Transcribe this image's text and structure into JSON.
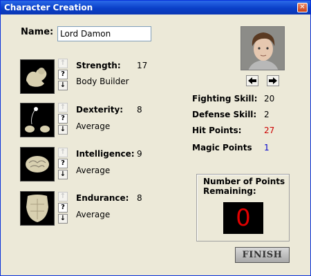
{
  "window": {
    "title": "Character Creation",
    "close_icon": "close-icon"
  },
  "name": {
    "label": "Name:",
    "value": "Lord Damon"
  },
  "attributes": [
    {
      "label": "Strength:",
      "value": "17",
      "description": "Body Builder",
      "icon": "flexed-arm-icon",
      "up_enabled": false,
      "down_enabled": true
    },
    {
      "label": "Dexterity:",
      "value": "8",
      "description": "Average",
      "icon": "juggling-hands-icon",
      "up_enabled": false,
      "down_enabled": true
    },
    {
      "label": "Intelligence:",
      "value": "9",
      "description": "Average",
      "icon": "brain-icon",
      "up_enabled": false,
      "down_enabled": true
    },
    {
      "label": "Endurance:",
      "value": "8",
      "description": "Average",
      "icon": "torso-icon",
      "up_enabled": false,
      "down_enabled": true
    }
  ],
  "buttons": {
    "help": "?",
    "up": "↑",
    "down": "↓",
    "prev": "🡐",
    "next": "🡒"
  },
  "stats": [
    {
      "label": "Fighting Skill:",
      "value": "20",
      "color": "#000000"
    },
    {
      "label": "Defense Skill:",
      "value": "2",
      "color": "#000000"
    },
    {
      "label": "Hit Points:",
      "value": "27",
      "color": "#cc0000"
    },
    {
      "label": "Magic Points",
      "value": "1",
      "color": "#0000cc"
    }
  ],
  "points": {
    "label": "Number of Points Remaining:",
    "value": "0"
  },
  "finish_label": "FINISH"
}
